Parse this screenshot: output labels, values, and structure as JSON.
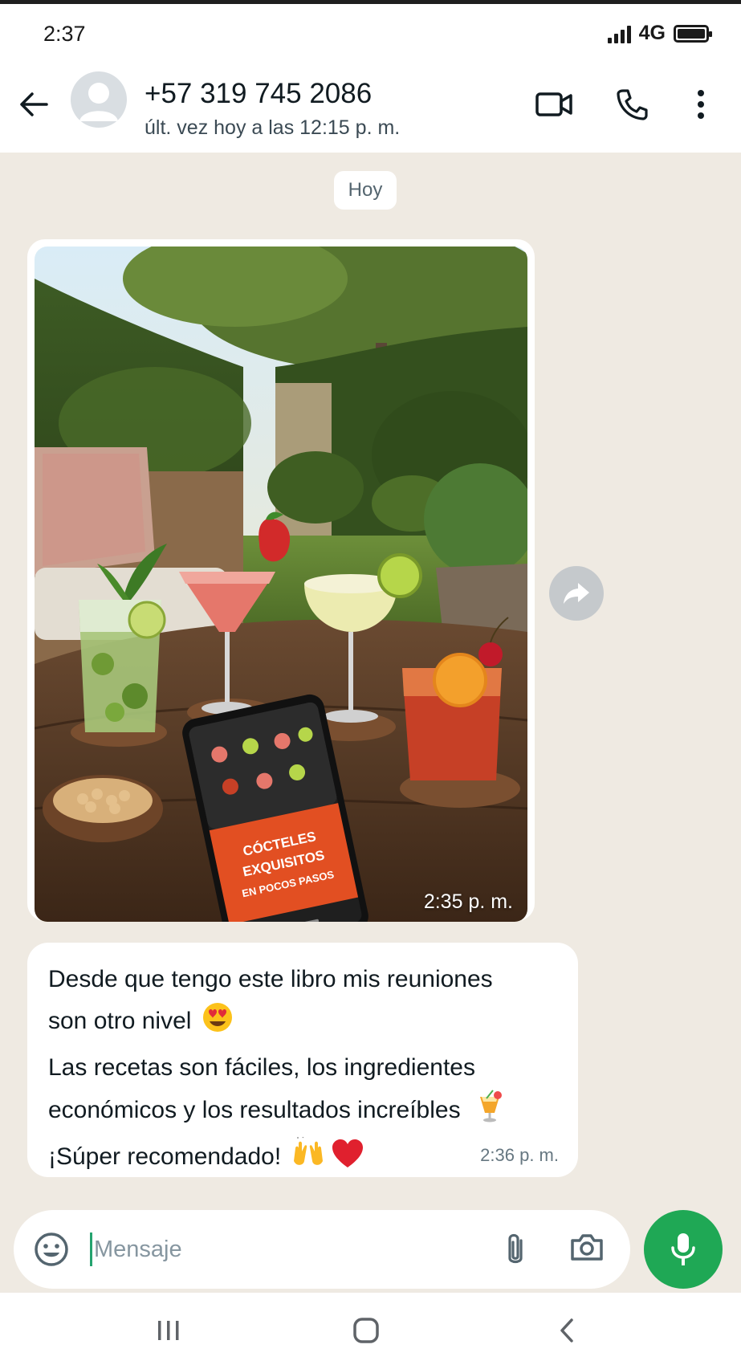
{
  "status_bar": {
    "time": "2:37",
    "network": "4G"
  },
  "header": {
    "contact_name": "+57 319 745 2086",
    "contact_status": "últ. vez hoy a las 12:15 p. m."
  },
  "chat": {
    "date_chip": "Hoy",
    "image_message": {
      "time": "2:35 p. m.",
      "phone_screen_text": [
        "CÓCTELES",
        "EXQUISITOS",
        "EN POCOS PASOS"
      ]
    },
    "text_message": {
      "lines": [
        "Desde que tengo este libro mis reuniones",
        "son otro nivel",
        "Las recetas son fáciles, los ingredientes",
        "económicos y los resultados increíbles",
        "¡Súper recomendado!"
      ],
      "emojis": [
        "😍",
        "🍹",
        "🙌",
        "❤️"
      ],
      "time": "2:36 p. m."
    }
  },
  "composer": {
    "placeholder": "Mensaje",
    "value": ""
  },
  "colors": {
    "accent": "#1fa855",
    "chat_bg": "#efeae2",
    "bubble": "#ffffff"
  },
  "icons": [
    "back-arrow-icon",
    "video-call-icon",
    "phone-call-icon",
    "more-options-icon",
    "forward-icon",
    "emoji-icon",
    "attach-icon",
    "camera-icon",
    "mic-icon"
  ]
}
